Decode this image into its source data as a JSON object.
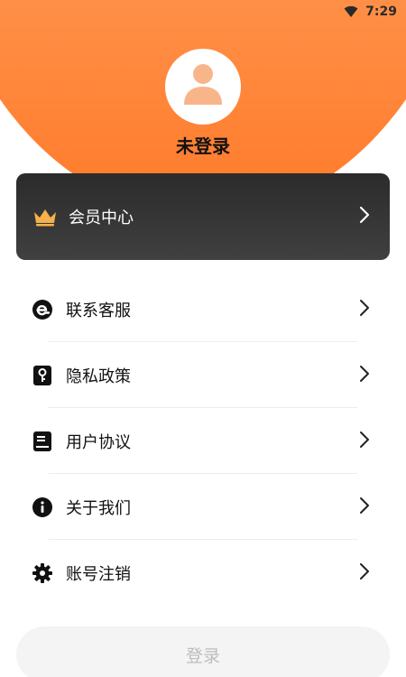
{
  "status_bar": {
    "time": "7:29",
    "wifi_icon": "wifi-icon"
  },
  "profile": {
    "avatar_icon": "user-avatar-icon",
    "name": "未登录"
  },
  "vip": {
    "icon": "crown-icon",
    "label": "会员中心",
    "chevron": "chevron-right-icon"
  },
  "menu": [
    {
      "icon": "customer-service-icon",
      "label": "联系客服"
    },
    {
      "icon": "privacy-key-icon",
      "label": "隐私政策"
    },
    {
      "icon": "document-icon",
      "label": "用户协议"
    },
    {
      "icon": "info-icon",
      "label": "关于我们"
    },
    {
      "icon": "gear-icon",
      "label": "账号注销"
    }
  ],
  "login": {
    "label": "登录"
  },
  "colors": {
    "header_gradient_top": "#ffc08a",
    "header_gradient_bottom": "#ff7a2a",
    "vip_card": "#333333",
    "crown": "#f5b14a"
  }
}
